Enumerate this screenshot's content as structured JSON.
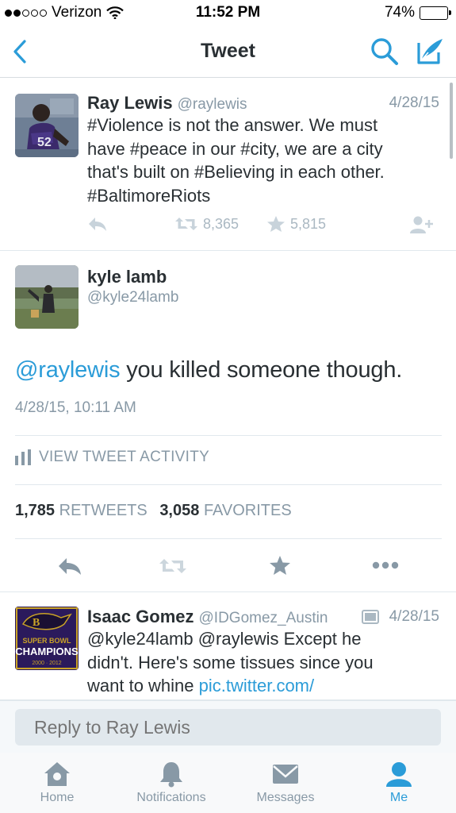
{
  "status_bar": {
    "carrier": "Verizon",
    "time": "11:52 PM",
    "battery": "74%",
    "battery_level": 0.74
  },
  "nav": {
    "title": "Tweet",
    "back_icon": "chevron-left-icon",
    "search_icon": "search-icon",
    "compose_icon": "compose-icon"
  },
  "parent_tweet": {
    "name": "Ray Lewis",
    "handle": "@raylewis",
    "date": "4/28/15",
    "lines": [
      "#Violence is not the answer. We must",
      "have #peace in our #city, we are a city",
      "that's built on #Believing in each other.",
      "#BaltimoreRiots"
    ],
    "retweets": "8,365",
    "favorites": "5,815"
  },
  "main_tweet": {
    "name": "kyle lamb",
    "handle": "@kyle24lamb",
    "mention": "@raylewis",
    "text": " you killed someone though.",
    "timestamp": "4/28/15, 10:11 AM",
    "activity_label": "VIEW TWEET ACTIVITY",
    "retweet_count": "1,785",
    "retweet_label": "RETWEETS",
    "favorite_count": "3,058",
    "favorite_label": "FAVORITES"
  },
  "reply_tweet": {
    "name": "Isaac Gomez",
    "handle": "@IDGomez_Austin",
    "date": "4/28/15",
    "mentions": "@kyle24lamb @raylewis",
    "line1_rest": " Except he",
    "line2": "didn't. Here's some tissues since you",
    "line3": "want to whine ",
    "link": "pic.twitter.com/",
    "avatar_lines": [
      "SUPER BOWL",
      "CHAMPIONS",
      "2000 · 2012"
    ]
  },
  "reply_bar": {
    "placeholder": "Reply to Ray Lewis"
  },
  "tabs": [
    {
      "label": "Home",
      "icon": "home-icon"
    },
    {
      "label": "Notifications",
      "icon": "bell-icon"
    },
    {
      "label": "Messages",
      "icon": "envelope-icon"
    },
    {
      "label": "Me",
      "icon": "person-icon"
    }
  ],
  "colors": {
    "accent": "#2b9cd8",
    "muted": "#8899a6",
    "text": "#292f33"
  }
}
